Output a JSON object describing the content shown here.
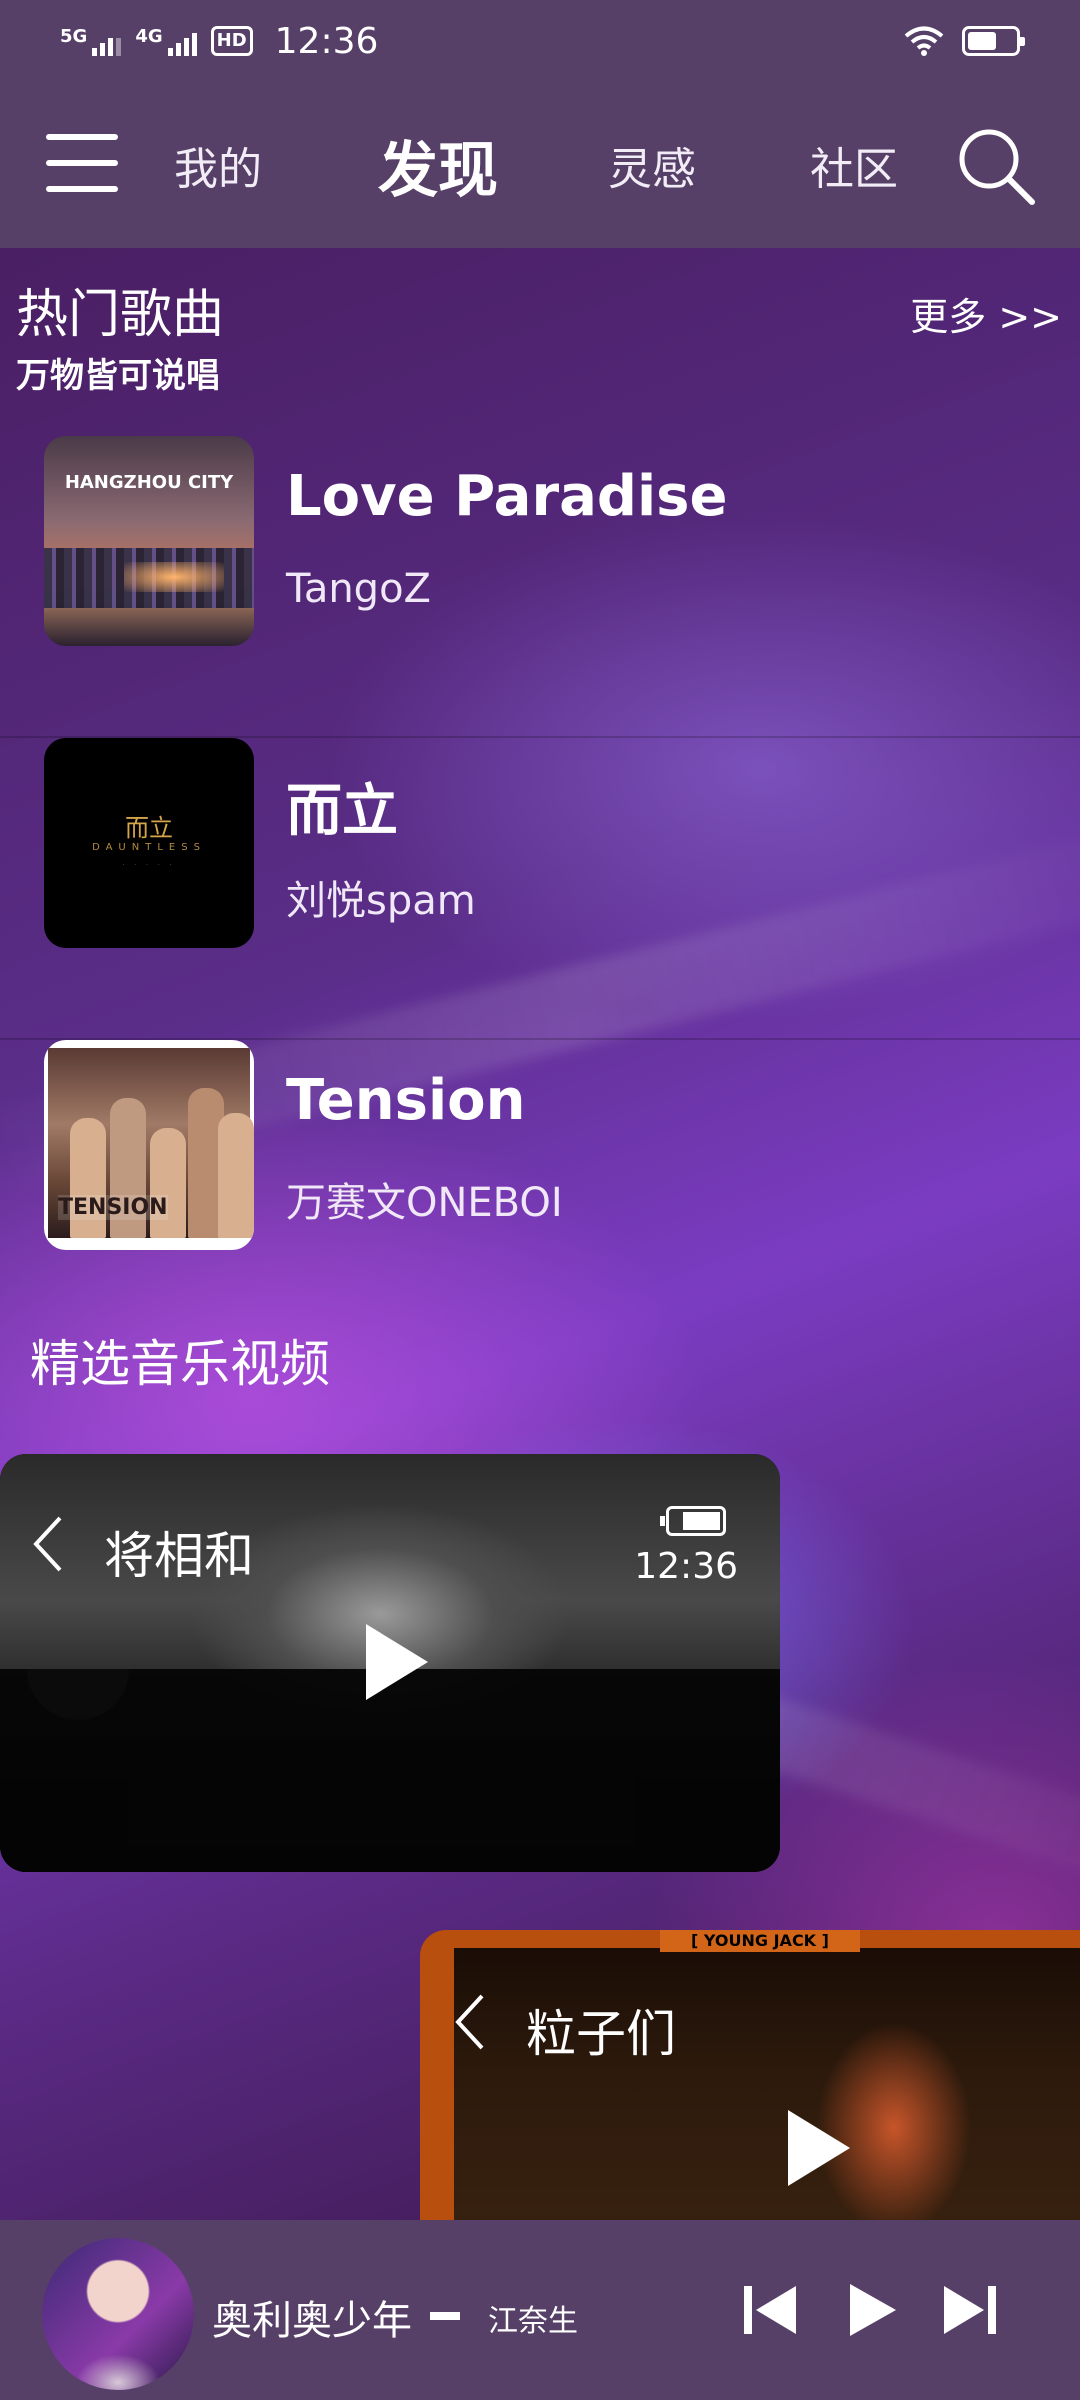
{
  "status_bar": {
    "network_1": "5G",
    "network_2": "4G",
    "hd_badge": "HD",
    "time": "12:36"
  },
  "nav": {
    "tabs": [
      {
        "label": "我的"
      },
      {
        "label": "发现"
      },
      {
        "label": "灵感"
      },
      {
        "label": "社区"
      }
    ],
    "active_tab": "发现",
    "icons": [
      "menu-icon",
      "search-icon"
    ]
  },
  "hot_songs": {
    "title": "热门歌曲",
    "subtitle": "万物皆可说唱",
    "more": "更多 >>",
    "items": [
      {
        "title": "Love Paradise",
        "artist": "TangoZ",
        "cover_text": "HANGZHOU CITY"
      },
      {
        "title": "而立",
        "artist": "刘悦spam",
        "cover_text": "而立",
        "cover_subtext": "DAUNTLESS"
      },
      {
        "title": "Tension",
        "artist": "万赛文ONEBOI",
        "cover_text": "TENSION"
      }
    ]
  },
  "videos": {
    "title": "精选音乐视频",
    "items": [
      {
        "title": "将相和",
        "time": "12:36"
      },
      {
        "title": "粒子们",
        "banner": "[ YOUNG JACK ]"
      }
    ]
  },
  "player": {
    "song": "奥利奥少年",
    "artist": "江奈生",
    "icons": [
      "previous-icon",
      "play-icon",
      "next-icon"
    ]
  },
  "colors": {
    "bar_bg": "#574068",
    "text": "#ffffff"
  }
}
